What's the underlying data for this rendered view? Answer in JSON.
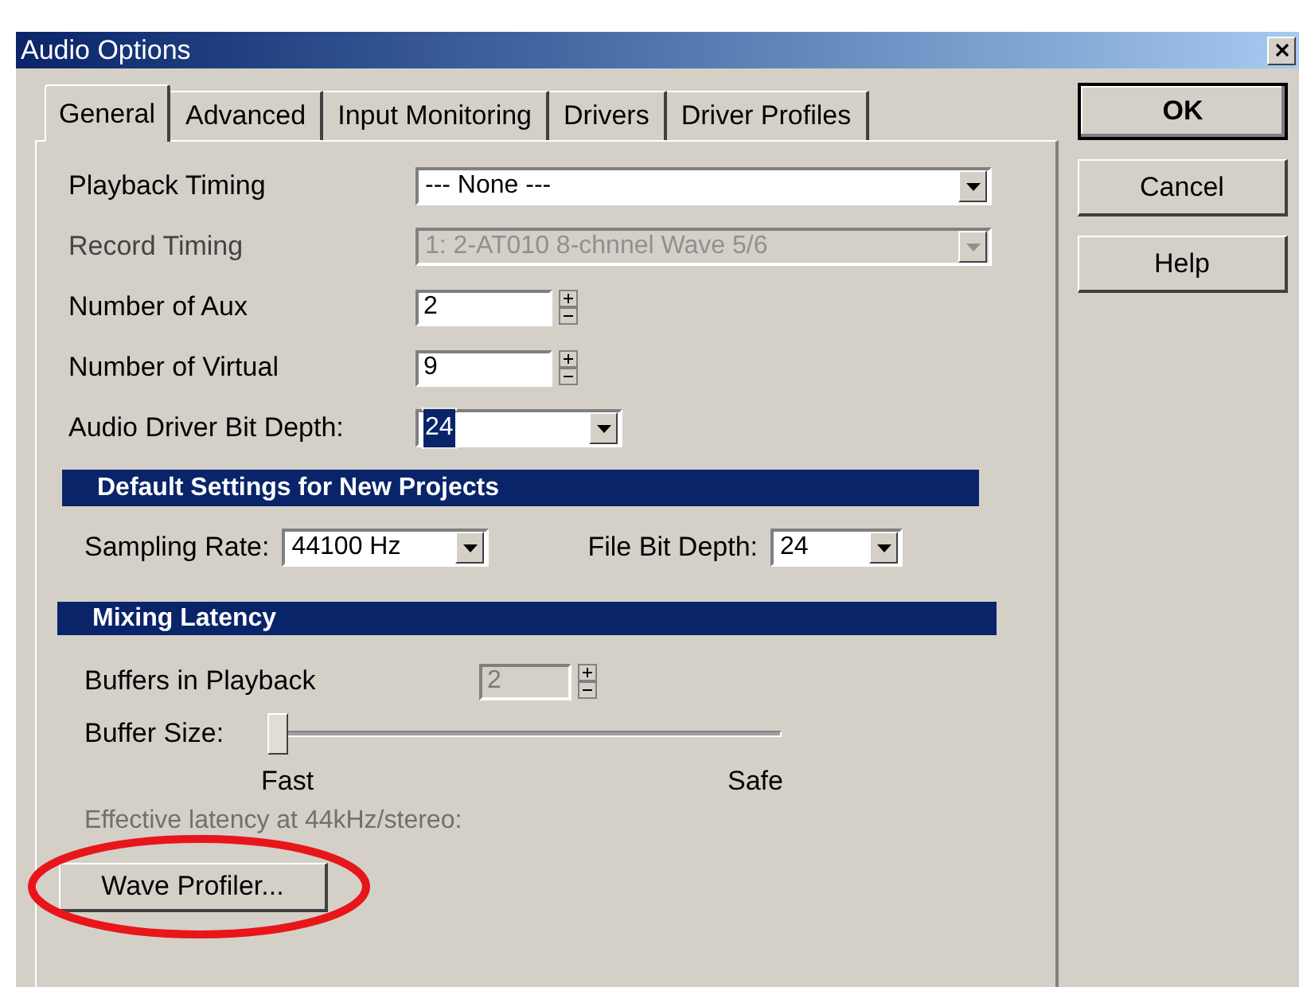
{
  "window": {
    "title": "Audio Options"
  },
  "tabs": [
    {
      "label": "General",
      "selected": true
    },
    {
      "label": "Advanced",
      "selected": false
    },
    {
      "label": "Input Monitoring",
      "selected": false
    },
    {
      "label": "Drivers",
      "selected": false
    },
    {
      "label": "Driver Profiles",
      "selected": false
    }
  ],
  "fields": [
    {
      "kind": "combo",
      "label": "Playback Timing",
      "value": "--- None ---",
      "disabled": false,
      "focused": false
    },
    {
      "kind": "combo",
      "label": "Record Timing",
      "value": "1: 2-AT010 8-chnnel Wave 5/6",
      "disabled": true,
      "focused": false
    },
    {
      "kind": "spin",
      "label": "Number of Aux",
      "value": "2",
      "disabled": false,
      "focused": false
    },
    {
      "kind": "spin",
      "label": "Number of Virtual",
      "value": "9",
      "disabled": false,
      "focused": false
    },
    {
      "kind": "combo",
      "label": "Audio Driver Bit Depth:",
      "value": "24",
      "disabled": false,
      "focused": true
    }
  ],
  "default_settings": {
    "title": "Default Settings for New Projects",
    "sampling_rate": {
      "label": "Sampling Rate:",
      "value": "44100 Hz"
    },
    "file_bit_depth": {
      "label": "File Bit Depth:",
      "value": "24"
    }
  },
  "mixing_latency": {
    "title": "Mixing Latency",
    "buffers": {
      "label": "Buffers in Playback",
      "value": "2",
      "disabled": true
    },
    "buffer_size": {
      "label": "Buffer Size:",
      "level": 0,
      "min_label": "Fast",
      "max_label": "Safe"
    },
    "latency": {
      "text": "Effective latency at 44kHz/stereo:",
      "disabled": true
    }
  },
  "wave_profiler_button": "Wave Profiler...",
  "highlight": {
    "kind": "ellipse"
  },
  "buttons": [
    {
      "label": "OK",
      "default": true
    },
    {
      "label": "Cancel",
      "default": false
    },
    {
      "label": "Help",
      "default": false
    }
  ]
}
